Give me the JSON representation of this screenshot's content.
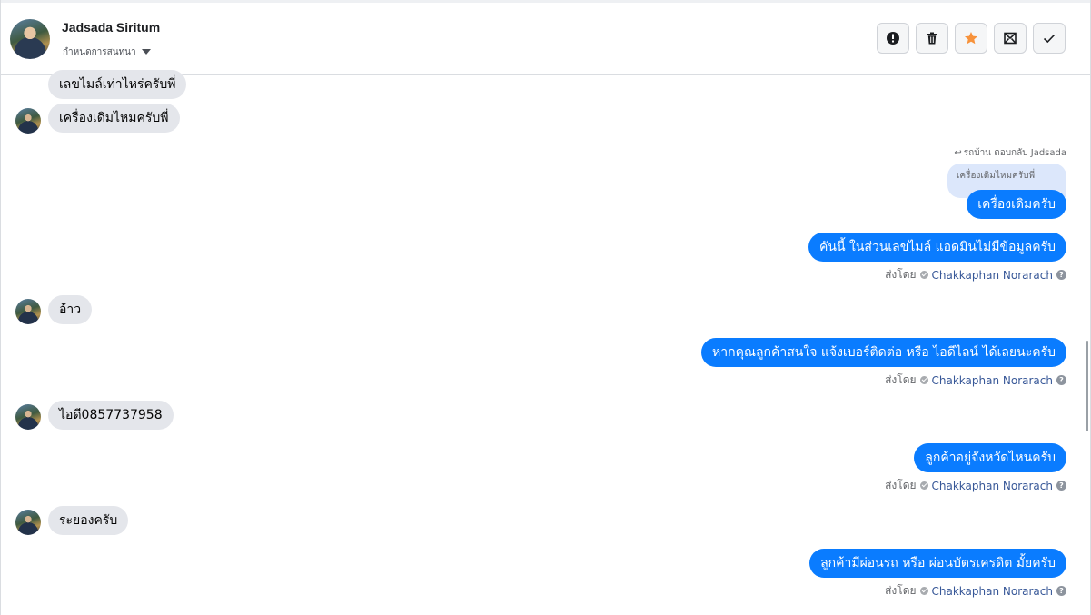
{
  "header": {
    "contact_name": "Jadsada Siritum",
    "sub_label": "กำหนดการสนทนา",
    "actions": [
      {
        "name": "report-button",
        "icon": "alert-circle-icon"
      },
      {
        "name": "delete-button",
        "icon": "trash-icon"
      },
      {
        "name": "star-button",
        "icon": "star-icon",
        "color": "#f7923b"
      },
      {
        "name": "mark-unread-button",
        "icon": "envelope-icon"
      },
      {
        "name": "done-button",
        "icon": "check-icon"
      }
    ]
  },
  "messages": {
    "in_1": "เลขไมล์เท่าไหร่ครับพี่",
    "in_2": "เครื่องเดิมไหมครับพี่",
    "reply_note": "รถบ้าน ตอบกลับ Jadsada",
    "quoted_text": "เครื่องเดิมไหมครับพี่",
    "out_1": "เครื่องเดิมครับ",
    "out_2": "คันนี้ ในส่วนเลขไมล์ แอดมินไม่มีข้อมูลครับ",
    "in_3": "อ้าว",
    "out_3": "หากคุณลูกค้าสนใจ แจ้งเบอร์ติดต่อ หรือ ไอดีไลน์ ได้เลยนะครับ",
    "in_4": "ไอดี0857737958",
    "out_4": "ลูกค้าอยู่จังหวัดไหนครับ",
    "in_5": "ระยองครับ",
    "out_5": "ลูกค้ามีผ่อนรถ หรือ ผ่อนบัตรเครดิต มั้ยครับ"
  },
  "sent_by": {
    "prefix": "ส่งโดย",
    "agent": "Chakkaphan Norarach",
    "help": "?"
  },
  "colors": {
    "outgoing_bubble": "#0a7cff",
    "incoming_bubble": "#e4e6eb",
    "agent_link": "#385898"
  }
}
